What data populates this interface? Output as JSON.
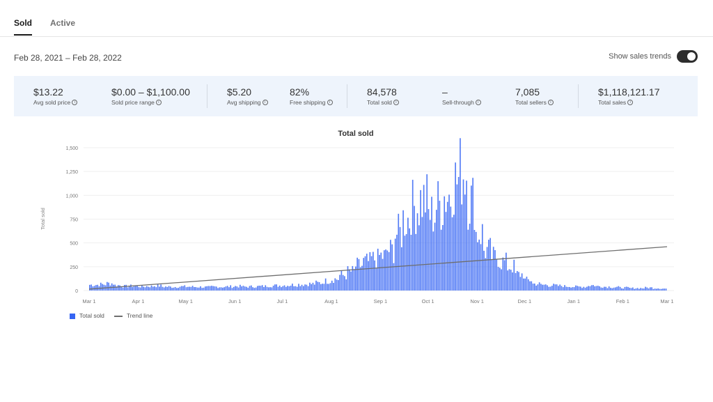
{
  "tabs": [
    {
      "label": "Sold",
      "active": true
    },
    {
      "label": "Active",
      "active": false
    }
  ],
  "date_range": "Feb 28, 2021 – Feb 28, 2022",
  "trend_toggle": {
    "label": "Show sales trends",
    "on": true
  },
  "stats": [
    [
      {
        "value": "$13.22",
        "label": "Avg sold price"
      },
      {
        "value": "$0.00 – $1,100.00",
        "label": "Sold price range"
      }
    ],
    [
      {
        "value": "$5.20",
        "label": "Avg shipping"
      },
      {
        "value": "82%",
        "label": "Free shipping"
      }
    ],
    [
      {
        "value": "84,578",
        "label": "Total sold"
      },
      {
        "value": "–",
        "label": "Sell-through"
      },
      {
        "value": "7,085",
        "label": "Total sellers"
      }
    ],
    [
      {
        "value": "$1,118,121.17",
        "label": "Total sales"
      }
    ]
  ],
  "info_glyph": "i",
  "colors": {
    "bar": "#3665f3",
    "trend": "#6e6e6e",
    "stats_bg": "#eef4fc"
  },
  "chart_data": {
    "type": "bar",
    "title": "Total sold",
    "xlabel": "",
    "ylabel": "Total sold",
    "ylim": [
      0,
      1500
    ],
    "yticks": [
      "0",
      "250",
      "500",
      "750",
      "1,000",
      "1,250",
      "1,500"
    ],
    "ytick_values": [
      0,
      250,
      500,
      750,
      1000,
      1250,
      1500
    ],
    "xticks": [
      "Mar 1",
      "Apr 1",
      "May 1",
      "Jun 1",
      "Jul 1",
      "Aug 1",
      "Sep 1",
      "Oct 1",
      "Nov 1",
      "Dec 1",
      "Jan 1",
      "Feb 1",
      "Mar 1"
    ],
    "xtick_days": [
      0,
      31,
      61,
      92,
      122,
      153,
      184,
      214,
      245,
      275,
      306,
      337,
      365
    ],
    "grid": true,
    "legend": {
      "position": "bottom-left",
      "entries": [
        "Total sold",
        "Trend line"
      ]
    },
    "series": [
      {
        "name": "Total sold",
        "kind": "bar",
        "weekly_avg_values": [
          60,
          65,
          75,
          55,
          45,
          48,
          42,
          45,
          50,
          40,
          38,
          42,
          40,
          38,
          36,
          40,
          38,
          42,
          45,
          40,
          42,
          45,
          50,
          52,
          55,
          60,
          65,
          70,
          80,
          100,
          120,
          160,
          200,
          260,
          300,
          330,
          360,
          420,
          600,
          750,
          880,
          950,
          800,
          900,
          1000,
          1150,
          1250,
          950,
          600,
          420,
          350,
          300,
          250,
          170,
          110,
          70,
          60,
          55,
          50,
          45,
          40,
          40,
          55,
          45,
          40,
          35,
          30,
          25,
          25,
          30,
          25,
          20
        ],
        "note": "daily bars approximated from weekly averages"
      },
      {
        "name": "Trend line",
        "kind": "line",
        "start": [
          0,
          15
        ],
        "end": [
          365,
          460
        ]
      }
    ]
  }
}
